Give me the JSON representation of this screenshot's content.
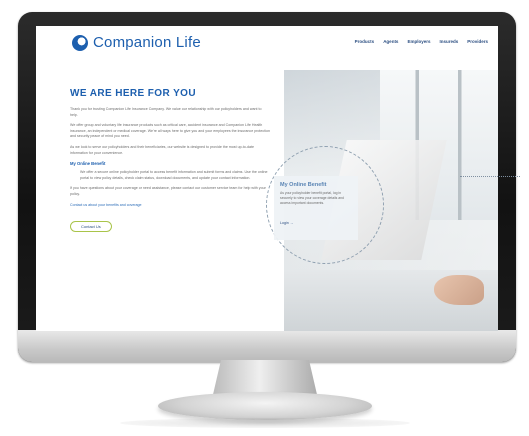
{
  "site": {
    "brand": "Companion Life",
    "nav": [
      "Products",
      "Agents",
      "Employers",
      "Insureds",
      "Providers"
    ]
  },
  "main": {
    "headline": "WE ARE HERE FOR YOU",
    "paragraphs": [
      "Thank you for trusting Companion Life Insurance Company. We value our relationship with our policyholders and want to help.",
      "We offer group and voluntary life insurance products such as critical care, accident insurance and Companion Life Health insurance, an independent or medical coverage. We're all ways here to give you and your employees the insurance protection and security peace of mind you need.",
      "As we look to serve our policyholders and their beneficiaries, our website is designed to provide the most up-to-date information for your convenience."
    ],
    "benefits_heading": "My Online Benefit",
    "benefits_text": "We offer a secure online policyholder portal to access benefit information and submit forms and claims. Use the online portal to view policy details, check claim status, download documents, and update your contact information.",
    "info_text": "If you have questions about your coverage or need assistance, please contact our customer service team for help with your policy.",
    "link_text": "Contact us about your benefits and coverage",
    "contact_button": "Contact Us"
  },
  "card": {
    "title": "My Online Benefit",
    "text": "As your policyholder benefit portal, log in securely to view your coverage details and access important documents.",
    "login": "Login →"
  }
}
